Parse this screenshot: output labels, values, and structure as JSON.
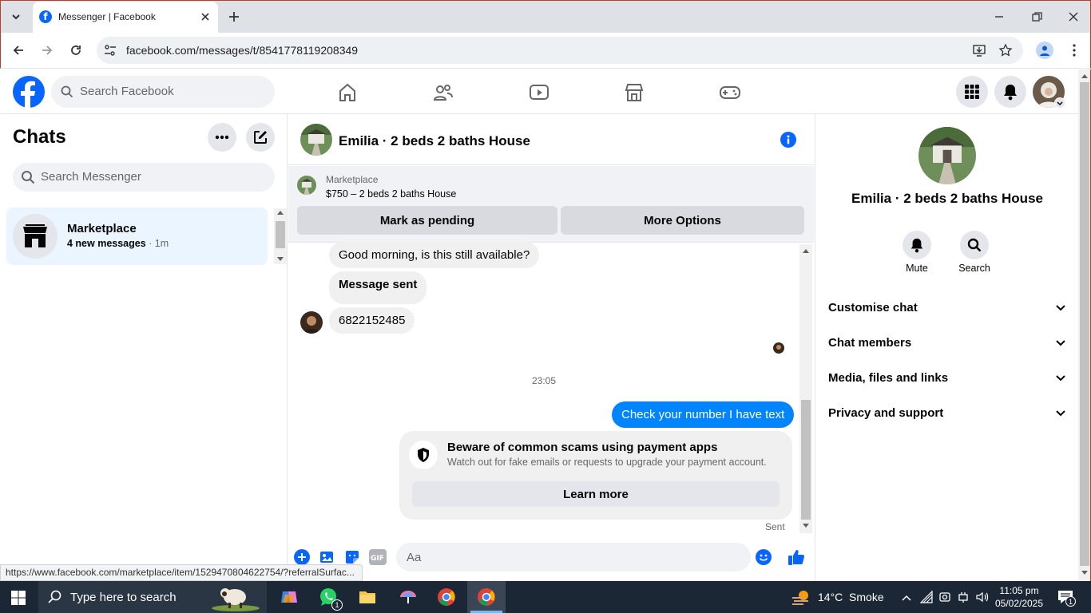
{
  "browser": {
    "tab_title": "Messenger | Facebook",
    "url": "facebook.com/messages/t/8541778119208349",
    "status_url": "https://www.facebook.com/marketplace/item/1529470804622754/?referralSurfac..."
  },
  "facebook": {
    "search_placeholder": "Search Facebook"
  },
  "chats": {
    "title": "Chats",
    "search_placeholder": "Search Messenger",
    "items": [
      {
        "name": "Marketplace",
        "meta_bold": "4 new messages",
        "meta_time": " · 1m"
      }
    ]
  },
  "conversation": {
    "title": "Emilia · 2 beds 2 baths House",
    "listing_source": "Marketplace",
    "listing_text": "$750 – 2 beds 2 baths House",
    "mark_pending": "Mark as pending",
    "more_options": "More Options",
    "messages": [
      "Good morning, is this still available?",
      "Message sent",
      "6822152485"
    ],
    "timestamp": "23:05",
    "outgoing": "Check your number I have text",
    "scam_title": "Beware of common scams using payment apps",
    "scam_body": "Watch out for fake emails or requests to upgrade your payment account.",
    "learn_more": "Learn more",
    "sent_status": "Sent",
    "composer_placeholder": "Aa"
  },
  "details": {
    "name": "Emilia · 2 beds 2 baths House",
    "mute": "Mute",
    "search": "Search",
    "sections": [
      "Customise chat",
      "Chat members",
      "Media, files and links",
      "Privacy and support"
    ]
  },
  "taskbar": {
    "search_placeholder": "Type here to search",
    "weather": "14°C  Smoke",
    "time": "11:05 pm",
    "date": "05/02/2025",
    "whatsapp_badge": "1",
    "notif_badge": "1"
  },
  "colors": {
    "fb_blue": "#0866ff",
    "messenger_blue": "#0084ff"
  }
}
